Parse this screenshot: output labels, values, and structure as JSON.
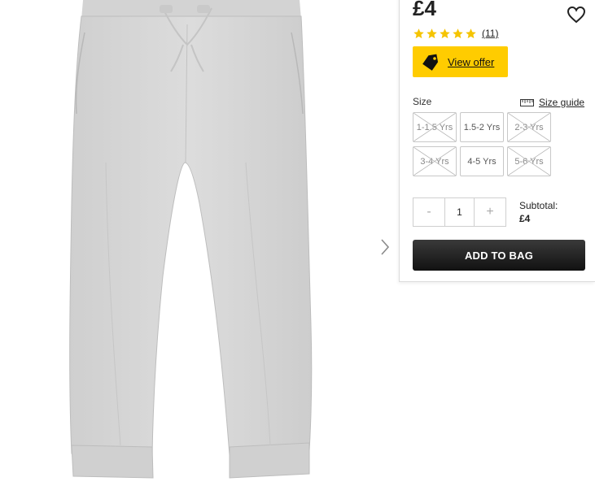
{
  "product": {
    "price": "£4",
    "review_count": "(11)",
    "rating": 5,
    "rating_max": 5
  },
  "offer": {
    "label": "View offer"
  },
  "size": {
    "label": "Size",
    "guide_label": "Size guide",
    "options": [
      {
        "label": "1-1.5 Yrs",
        "available": false
      },
      {
        "label": "1.5-2 Yrs",
        "available": true
      },
      {
        "label": "2-3 Yrs",
        "available": false
      },
      {
        "label": "3-4 Yrs",
        "available": false
      },
      {
        "label": "4-5 Yrs",
        "available": true
      },
      {
        "label": "5-6 Yrs",
        "available": false
      }
    ]
  },
  "quantity": {
    "minus": "-",
    "value": "1",
    "plus": "+"
  },
  "subtotal": {
    "label": "Subtotal:",
    "amount": "£4"
  },
  "cart": {
    "add_label": "ADD TO BAG"
  },
  "colors": {
    "accent": "#ffcc00",
    "star": "#f5c400",
    "button_dark": "#1a1a1a"
  },
  "icons": {
    "wishlist": "heart-icon",
    "offer": "tag-icon",
    "size_guide": "ruler-icon",
    "next": "chevron-right-icon"
  }
}
